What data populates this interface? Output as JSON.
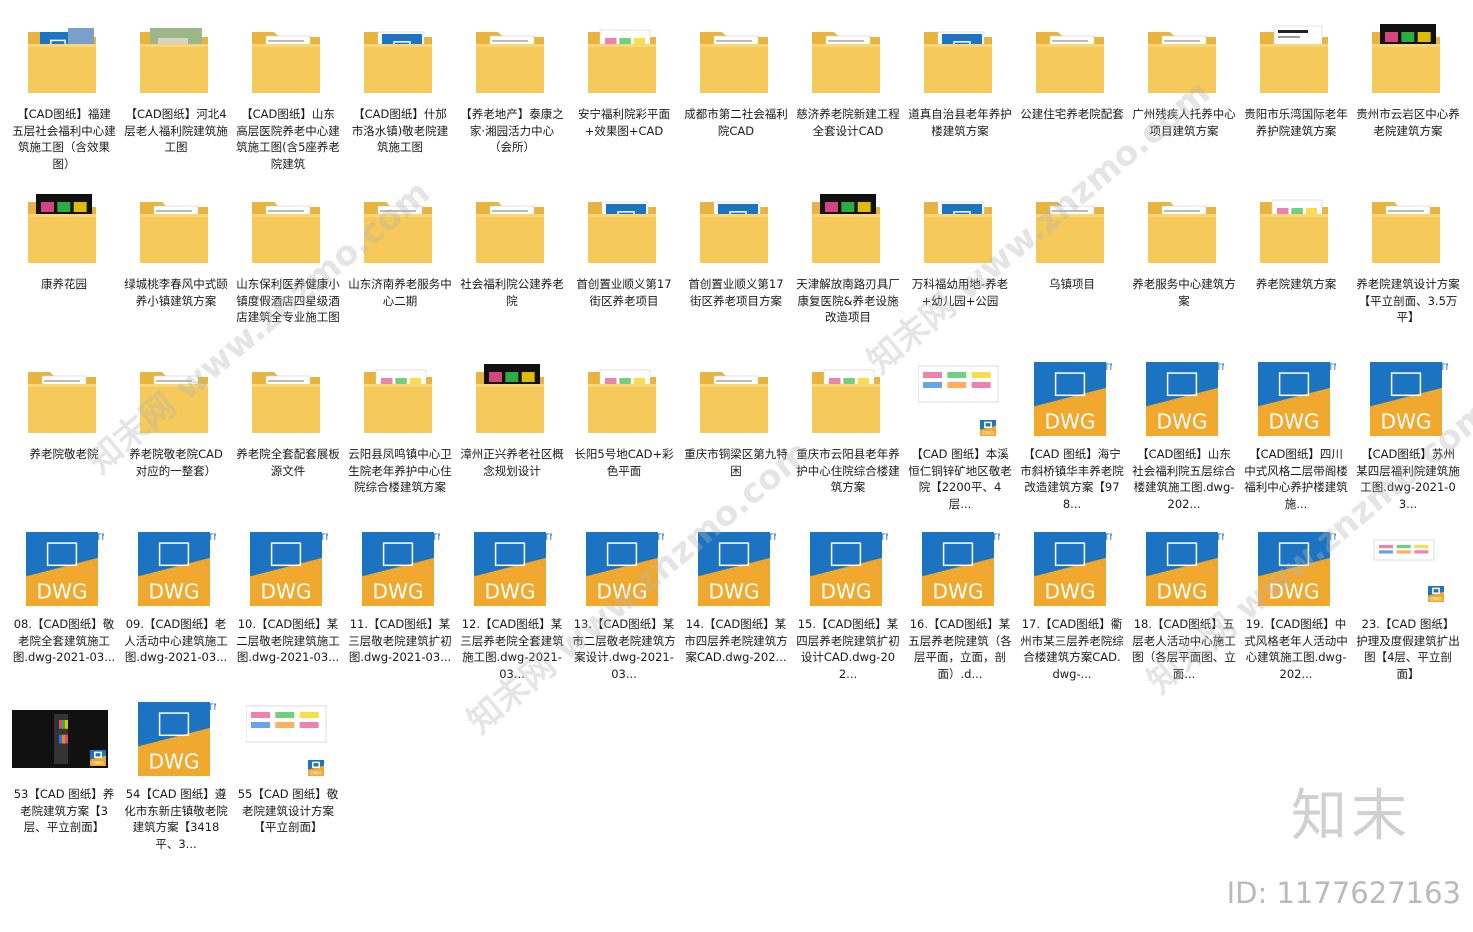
{
  "colors": {
    "folder": "#f5c95a",
    "folder_back": "#e8b43e",
    "dwg_blue": "#1b73c2",
    "dwg_orange": "#f0a92e",
    "dark": "#111111"
  },
  "watermark": {
    "brand": "知末",
    "id": "ID: 1177627163",
    "site": "www.znzmo.com"
  },
  "items": [
    {
      "label": "【CAD图纸】福建五层社会福利中心建筑施工图（含效果图）",
      "icon": "folder-dwg-photo"
    },
    {
      "label": "【CAD图纸】河北4层老人福利院建筑施工图",
      "icon": "folder-photo"
    },
    {
      "label": "【CAD图纸】山东高层医院养老中心建筑施工图(含5座养老院建筑",
      "icon": "folder"
    },
    {
      "label": "【CAD图纸】什邡市洛水镇)敬老院建筑施工图",
      "icon": "folder-dwg"
    },
    {
      "label": "【养老地产】泰康之家·湘园活力中心（会所）",
      "icon": "folder"
    },
    {
      "label": "安宁福利院彩平面+效果图+CAD",
      "icon": "folder-plan"
    },
    {
      "label": "成都市第二社会福利院CAD",
      "icon": "folder"
    },
    {
      "label": "慈济养老院新建工程全套设计CAD",
      "icon": "folder"
    },
    {
      "label": "道真自治县老年养护楼建筑方案",
      "icon": "folder-dwg"
    },
    {
      "label": "公建住宅养老院配套",
      "icon": "folder"
    },
    {
      "label": "广州残疾人托养中心项目建筑方案",
      "icon": "folder"
    },
    {
      "label": "贵阳市乐湾国际老年养护院建筑方案",
      "icon": "folder-doc"
    },
    {
      "label": "贵州市云岩区中心养老院建筑方案",
      "icon": "folder-dark"
    },
    {
      "label": "康养花园",
      "icon": "folder-dark"
    },
    {
      "label": "绿城桃李春风中式颐养小镇建筑方案",
      "icon": "folder"
    },
    {
      "label": "山东保利医养健康小镇度假酒店四星级酒店建筑全专业施工图",
      "icon": "folder"
    },
    {
      "label": "山东济南养老服务中心二期",
      "icon": "folder"
    },
    {
      "label": "社会福利院公建养老院",
      "icon": "folder"
    },
    {
      "label": "首创置业顺义第17街区养老项目",
      "icon": "folder-dwg"
    },
    {
      "label": "首创置业顺义第17街区养老项目方案",
      "icon": "folder-dwg"
    },
    {
      "label": "天津解放南路刃具厂康复医院&养老设施改造项目",
      "icon": "folder-dark"
    },
    {
      "label": "万科福幼用地-养老+幼儿园+公园",
      "icon": "folder-dwg"
    },
    {
      "label": "乌镇项目",
      "icon": "folder"
    },
    {
      "label": "养老服务中心建筑方案",
      "icon": "folder"
    },
    {
      "label": "养老院建筑方案",
      "icon": "folder-plan"
    },
    {
      "label": "养老院建筑设计方案【平立剖面、3.5万平】",
      "icon": "folder"
    },
    {
      "label": "养老院敬老院",
      "icon": "folder"
    },
    {
      "label": "养老院敬老院CAD对应的一整套）",
      "icon": "folder"
    },
    {
      "label": "养老院全套配套展板源文件",
      "icon": "folder"
    },
    {
      "label": "云阳县凤鸣镇中心卫生院老年养护中心住院综合楼建筑方案",
      "icon": "folder-plan"
    },
    {
      "label": "漳州正兴养老社区概念规划设计",
      "icon": "folder-dark"
    },
    {
      "label": "长阳5号地CAD+彩色平面",
      "icon": "folder-plan"
    },
    {
      "label": "重庆市铜梁区第九特困",
      "icon": "folder"
    },
    {
      "label": "重庆市云阳县老年养护中心住院综合楼建筑方案",
      "icon": "folder-plan"
    },
    {
      "label": "【CAD 图纸】本溪恒仁铜锌矿地区敬老院【2200平、4层...",
      "icon": "thumb"
    },
    {
      "label": "【CAD 图纸】海宁市斜桥镇华丰养老院改造建筑方案【978...",
      "icon": "dwg"
    },
    {
      "label": "【CAD图纸】山东社会福利院五层综合楼建筑施工图.dwg-202...",
      "icon": "dwg"
    },
    {
      "label": "【CAD图纸】四川中式风格二层带阁楼福利中心养护楼建筑施...",
      "icon": "dwg"
    },
    {
      "label": "【CAD图纸】苏州某四层福利院建筑施工图.dwg-2021-03...",
      "icon": "dwg"
    },
    {
      "label": "08.【CAD图纸】敬老院全套建筑施工图.dwg-2021-03...",
      "icon": "dwg"
    },
    {
      "label": "09.【CAD图纸】老人活动中心建筑施工图.dwg-2021-03...",
      "icon": "dwg"
    },
    {
      "label": "10.【CAD图纸】某二层敬老院建筑施工图.dwg-2021-03...",
      "icon": "dwg"
    },
    {
      "label": "11.【CAD图纸】某三层敬老院建筑扩初图.dwg-2021-03...",
      "icon": "dwg"
    },
    {
      "label": "12.【CAD图纸】某三层养老院全套建筑施工图.dwg-2021-03...",
      "icon": "dwg"
    },
    {
      "label": "13.【CAD图纸】某市二层敬老院建筑方案设计.dwg-2021-03...",
      "icon": "dwg"
    },
    {
      "label": "14.【CAD图纸】某市四层养老院建筑方案CAD.dwg-202...",
      "icon": "dwg"
    },
    {
      "label": "15.【CAD图纸】某四层养老院建筑扩初设计CAD.dwg-202...",
      "icon": "dwg"
    },
    {
      "label": "16.【CAD图纸】某五层养老院建筑（各层平面，立面，剖面）.d...",
      "icon": "dwg"
    },
    {
      "label": "17.【CAD图纸】衢州市某三层养老院综合楼建筑方案CAD.dwg-...",
      "icon": "dwg"
    },
    {
      "label": "18.【CAD图纸】五层老人活动中心施工图（各层平面图、立面...",
      "icon": "dwg"
    },
    {
      "label": "19.【CAD图纸】中式风格老年人活动中心建筑施工图.dwg-202...",
      "icon": "dwg"
    },
    {
      "label": "23.【CAD 图纸】护理及度假建筑扩出图【4层、平立剖面】",
      "icon": "thumb-small"
    },
    {
      "label": "53【CAD 图纸】养老院建筑方案【3层、平立剖面】",
      "icon": "thumb-dark"
    },
    {
      "label": "54【CAD 图纸】遵化市东新庄镇敬老院建筑方案【3418平、3...",
      "icon": "dwg"
    },
    {
      "label": "55【CAD 图纸】敬老院建筑设计方案【平立剖面】",
      "icon": "thumb"
    }
  ]
}
